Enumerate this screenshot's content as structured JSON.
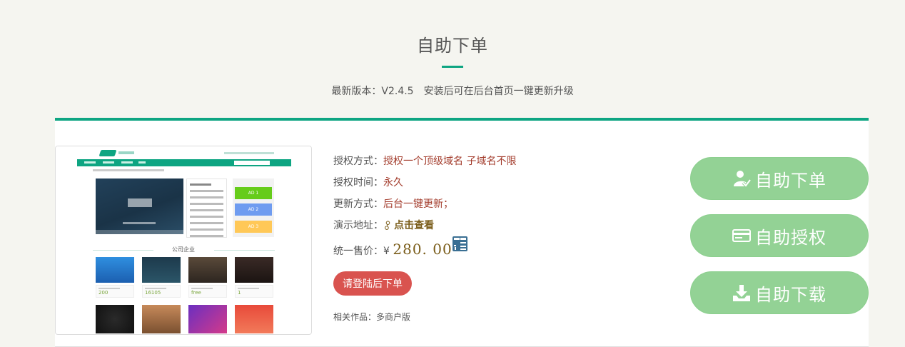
{
  "header": {
    "title": "自助下单",
    "version_text": "最新版本：V2.4.5",
    "update_note": "安装后可在后台首页一键更新升级"
  },
  "preview": {
    "section_title": "公司企业",
    "ads": [
      "AD 1",
      "AD 2",
      "AD 3"
    ],
    "ad_colors": [
      "#66cc1a",
      "#6f9cf0",
      "#ffc857"
    ],
    "thumbnail_prices": [
      "200",
      "16105",
      "free",
      "1"
    ]
  },
  "product": {
    "auth_method_label": "授权方式：",
    "auth_method_value": "授权一个顶级域名 子域名不限",
    "auth_time_label": "授权时间：",
    "auth_time_value": "永久",
    "update_label": "更新方式：",
    "update_value": "后台一键更新；",
    "demo_label": "演示地址：",
    "demo_link": "点击查看",
    "price_label": "统一售价：",
    "currency": "¥",
    "price": "280. 00",
    "login_button": "请登陆后下单",
    "related_text": "相关作品：多商户版"
  },
  "actions": [
    {
      "label": "自助下单",
      "icon": "user-check-icon"
    },
    {
      "label": "自助授权",
      "icon": "card-icon"
    },
    {
      "label": "自助下载",
      "icon": "download-tray-icon"
    }
  ],
  "colors": {
    "accent": "#0ea582",
    "action_button": "#93d295",
    "login_button": "#d9534f",
    "price": "#7a5d1a",
    "value_text": "#a33c2c"
  }
}
